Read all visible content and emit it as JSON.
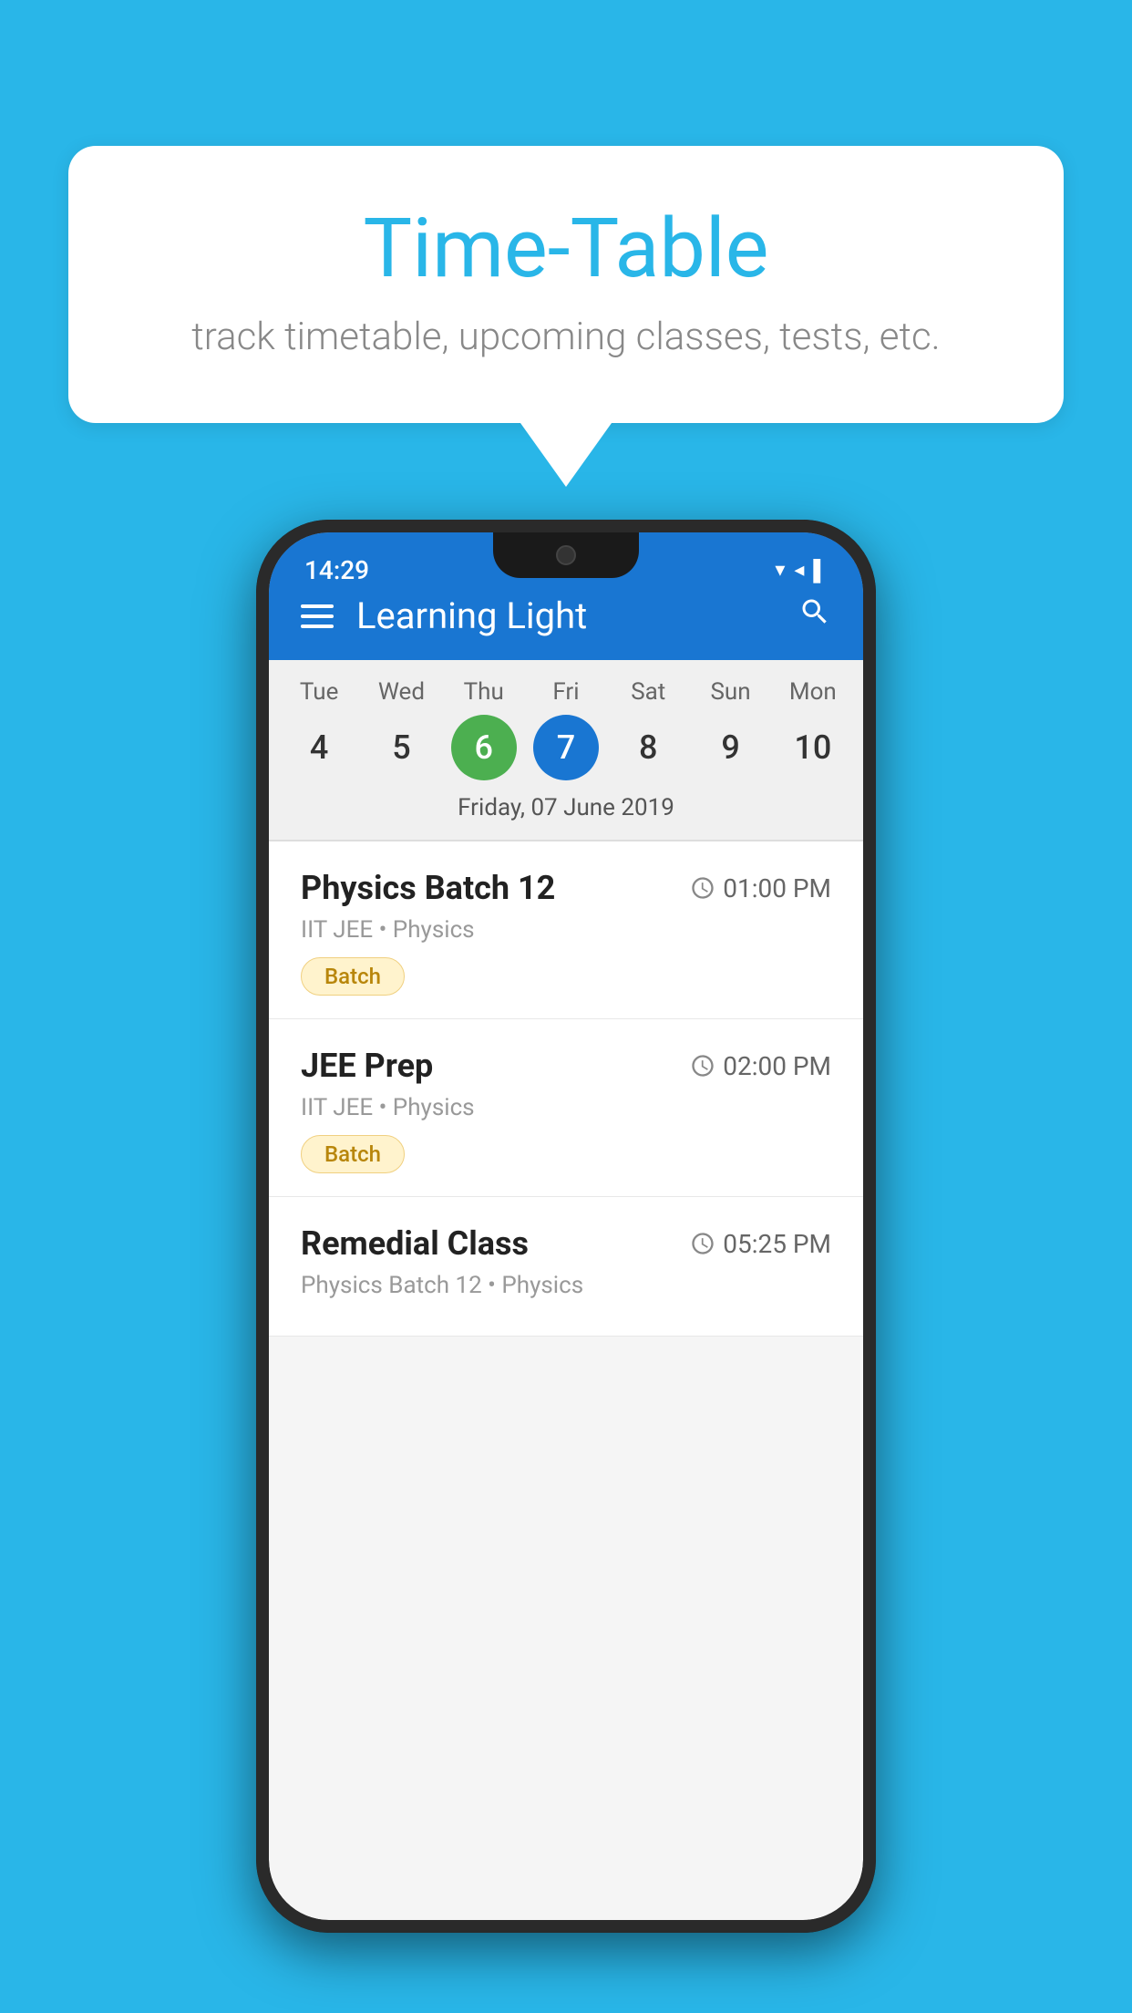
{
  "background_color": "#29B6E8",
  "speech_bubble": {
    "title": "Time-Table",
    "subtitle": "track timetable, upcoming classes, tests, etc."
  },
  "phone": {
    "status_bar": {
      "time": "14:29",
      "icons": "▾◂▌"
    },
    "app_bar": {
      "title": "Learning Light",
      "search_label": "search"
    },
    "calendar": {
      "days": [
        "Tue",
        "Wed",
        "Thu",
        "Fri",
        "Sat",
        "Sun",
        "Mon"
      ],
      "dates": [
        "4",
        "5",
        "6",
        "7",
        "8",
        "9",
        "10"
      ],
      "today_index": 2,
      "selected_index": 3,
      "selected_label": "Friday, 07 June 2019"
    },
    "schedule": [
      {
        "title": "Physics Batch 12",
        "time": "01:00 PM",
        "subtitle": "IIT JEE • Physics",
        "badge": "Batch"
      },
      {
        "title": "JEE Prep",
        "time": "02:00 PM",
        "subtitle": "IIT JEE • Physics",
        "badge": "Batch"
      },
      {
        "title": "Remedial Class",
        "time": "05:25 PM",
        "subtitle": "Physics Batch 12 • Physics",
        "badge": ""
      }
    ]
  }
}
